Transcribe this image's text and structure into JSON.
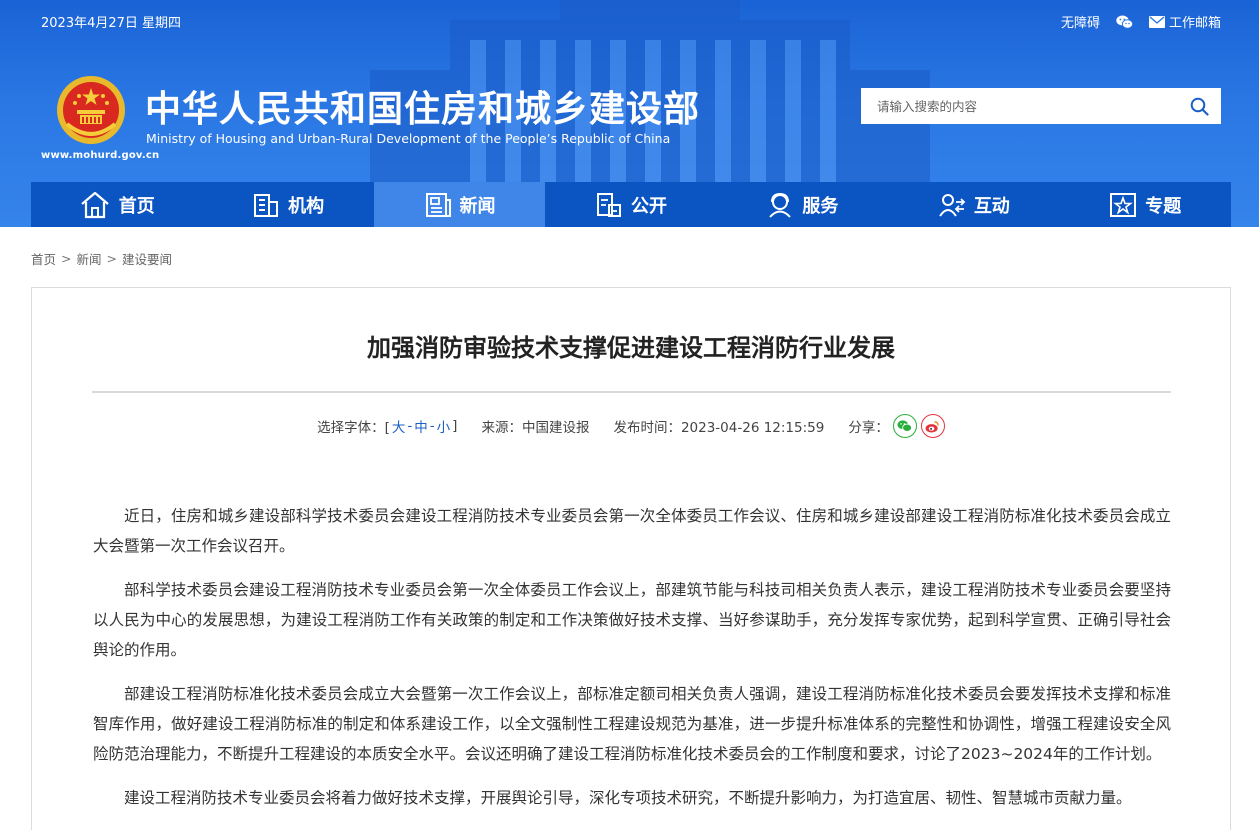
{
  "header": {
    "date": "2023年4月27日 星期四",
    "top_links": [
      {
        "label": "无障碍",
        "icon": "accessibility"
      },
      {
        "label": "",
        "icon": "wechat-icon"
      },
      {
        "label": "工作邮箱",
        "icon": "mail-icon"
      }
    ],
    "site_title": "中华人民共和国住房和城乡建设部",
    "site_subtitle": "Ministry of Housing and Urban-Rural Development of the People’s Republic of China",
    "site_url": "www.mohurd.gov.cn",
    "search_placeholder": "请输入搜索的内容",
    "colors": {
      "header_blue": "#2a77e4",
      "nav_blue": "#0b55c3",
      "nav_active": "#3f86e8"
    }
  },
  "nav": {
    "items": [
      {
        "label": "首页",
        "icon": "home-icon"
      },
      {
        "label": "机构",
        "icon": "building-icon"
      },
      {
        "label": "新闻",
        "icon": "news-icon",
        "active": true
      },
      {
        "label": "公开",
        "icon": "disclosure-icon"
      },
      {
        "label": "服务",
        "icon": "service-icon"
      },
      {
        "label": "互动",
        "icon": "interact-icon"
      },
      {
        "label": "专题",
        "icon": "topic-icon"
      }
    ]
  },
  "breadcrumb": [
    "首页",
    "新闻",
    "建设要闻"
  ],
  "article": {
    "title": "加强消防审验技术支撑促进建设工程消防行业发展",
    "font_label": "选择字体：[",
    "font_sizes": [
      "大",
      "中",
      "小"
    ],
    "font_close": "]",
    "source": "来源：中国建设报",
    "publish_time": "发布时间：2023-04-26 12:15:59",
    "share_label": "分享：",
    "paragraphs": [
      "近日，住房和城乡建设部科学技术委员会建设工程消防技术专业委员会第一次全体委员工作会议、住房和城乡建设部建设工程消防标准化技术委员会成立大会暨第一次工作会议召开。",
      "部科学技术委员会建设工程消防技术专业委员会第一次全体委员工作会议上，部建筑节能与科技司相关负责人表示，建设工程消防技术专业委员会要坚持以人民为中心的发展思想，为建设工程消防工作有关政策的制定和工作决策做好技术支撑、当好参谋助手，充分发挥专家优势，起到科学宣贯、正确引导社会舆论的作用。",
      "部建设工程消防标准化技术委员会成立大会暨第一次工作会议上，部标准定额司相关负责人强调，建设工程消防标准化技术委员会要发挥技术支撑和标准智库作用，做好建设工程消防标准的制定和体系建设工作，以全文强制性工程建设规范为基准，进一步提升标准体系的完整性和协调性，增强工程建设安全风险防范治理能力，不断提升工程建设的本质安全水平。会议还明确了建设工程消防标准化技术委员会的工作制度和要求，讨论了2023~2024年的工作计划。",
      "建设工程消防技术专业委员会将着力做好技术支撑，开展舆论引导，深化专项技术研究，不断提升影响力，为打造宜居、韧性、智慧城市贡献力量。"
    ]
  }
}
